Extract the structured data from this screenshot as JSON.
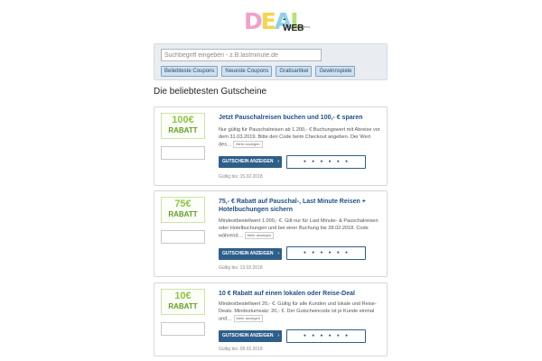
{
  "logo": {
    "letters": [
      "D",
      "E",
      "A",
      "L"
    ],
    "suffix": "-WEB",
    "tagline": "GUTSCHEINPORTAL"
  },
  "search": {
    "placeholder": "Suchbegriff eingeben - z.B.lastminute.de"
  },
  "filters": [
    "Beliebteste Coupons",
    "Neueste Coupons",
    "Gratisartikel",
    "Gewinnspiele"
  ],
  "page_title": "Die beliebtesten Gutscheine",
  "deals": [
    {
      "amount": "100€",
      "badge_label": "RABATT",
      "title": "Jetzt Pauschalreisen buchen und 100,- € sparen",
      "description": "Nur gültig für Pauschalreisen ab 1.200,- € Buchungswert mit Abreise vor dem 31.03.2019. Bitte den Code beim Checkout angeben. Der Wert des…",
      "more_label": "Mehr anzeigen",
      "button_label": "GUTSCHEIN ANZEIGEN",
      "code_mask": "• • • • • •",
      "valid_until": "Gültig bis: 15.02.2018"
    },
    {
      "amount": "75€",
      "badge_label": "RABATT",
      "title": "75,- € Rabatt auf Pauschal-, Last Minute Reisen + Hotelbuchungen sichern",
      "description": "Mindestbestellwert 1.000,- €. Gilt nur für Last Minute- & Pauschalreisen oder Hotelbuchungen und bei einer Buchung bis 28.02.2018. Code während…",
      "more_label": "Mehr anzeigen",
      "button_label": "GUTSCHEIN ANZEIGEN",
      "code_mask": "• • • • • •",
      "valid_until": "Gültig bis: 13.02.2018"
    },
    {
      "amount": "10€",
      "badge_label": "RABATT",
      "title": "10 € Rabatt auf einen lokalen oder Reise-Deal",
      "description": "Mindestbestellwert 20,- €. Gültig für alle Kunden und lokale und Reise-Deals. Mindestumsatz: 20,- €. Der Gutscheincode ist je Kunde einmal und…",
      "more_label": "Mehr anzeigen",
      "button_label": "GUTSCHEIN ANZEIGEN",
      "code_mask": "• • • • • •",
      "valid_until": "Gültig bis: 08.02.2018"
    }
  ]
}
